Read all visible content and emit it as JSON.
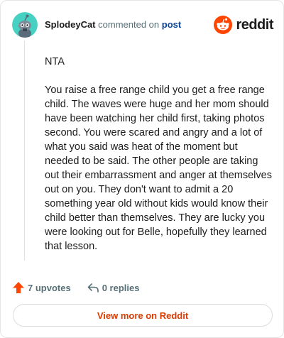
{
  "comment": {
    "author": "SplodeyCat",
    "action_text": "commented on",
    "post_link": "post",
    "avatar_icon": "snoo-avatar-icon",
    "paragraphs": [
      "NTA",
      "You raise a free range child you get a free range child. The waves were huge and her mom should have been watching her child first, taking photos second. You were scared and angry and a lot of what you said was heat of the moment but needed to be said. The other people are taking out their embarrassment and anger at themselves out on you. They don't want to admit a 20 something year old without kids would know their child better than themselves. They are lucky you were looking out for Belle, hopefully they learned that lesson."
    ]
  },
  "brand": {
    "name": "reddit",
    "icon": "reddit-logo-icon",
    "color": "#ff4500"
  },
  "actions": {
    "upvotes": "7 upvotes",
    "upvote_icon": "upvote-arrow-icon",
    "replies": "0 replies",
    "reply_icon": "reply-arrow-icon"
  },
  "view_more": {
    "label": "View more on Reddit",
    "color": "#d93a00"
  }
}
